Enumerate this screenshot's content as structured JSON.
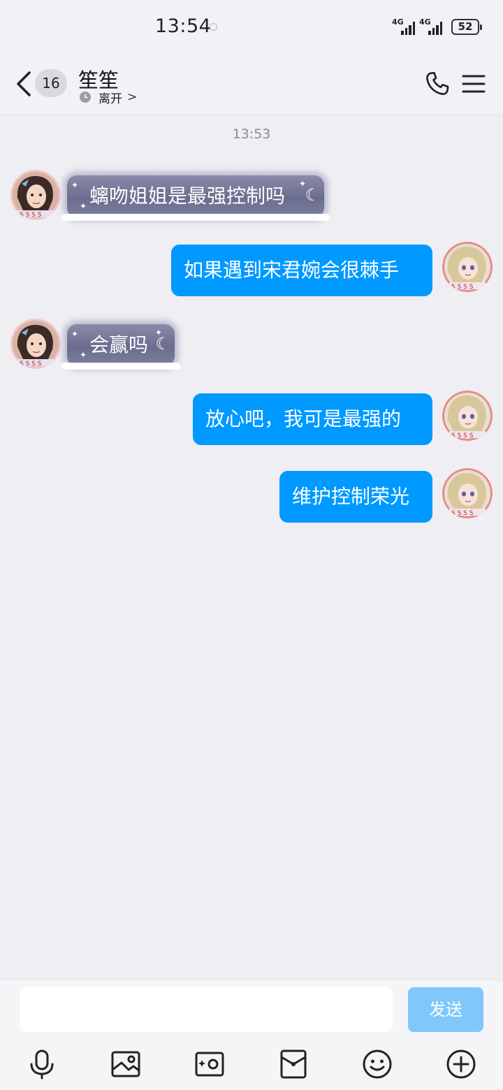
{
  "status_bar": {
    "time": "13:54",
    "network_1": "4G",
    "network_2": "4G",
    "battery": "52"
  },
  "header": {
    "back_badge": "16",
    "contact_name": "笙笙",
    "presence": "离开",
    "presence_chevron": ">"
  },
  "chat": {
    "timestamp": "13:53",
    "messages": [
      {
        "side": "in",
        "text": "螭吻姐姐是最强控制吗"
      },
      {
        "side": "out",
        "text": "如果遇到宋君婉会很棘手"
      },
      {
        "side": "in",
        "text": "会赢吗"
      },
      {
        "side": "out",
        "text": "放心吧，我可是最强的"
      },
      {
        "side": "out",
        "text": "维护控制荣光"
      }
    ]
  },
  "composer": {
    "input_value": "",
    "send_label": "发送",
    "tools": [
      "microphone-icon",
      "image-icon",
      "camera-icon",
      "red-packet-icon",
      "emoji-icon",
      "plus-icon"
    ]
  },
  "colors": {
    "accent": "#0099ff",
    "send_disabled": "#80c8fb",
    "background": "#eeeef3"
  }
}
